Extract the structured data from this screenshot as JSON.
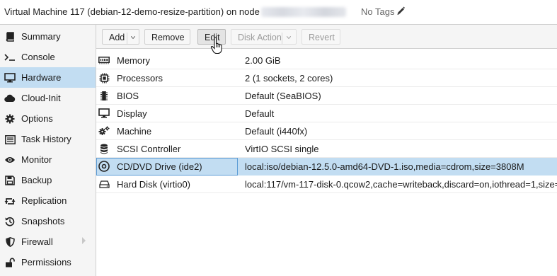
{
  "header": {
    "title": "Virtual Machine 117 (debian-12-demo-resize-partition) on node",
    "tags": "No Tags"
  },
  "sidebar": {
    "items": [
      {
        "label": "Summary",
        "icon": "book-icon"
      },
      {
        "label": "Console",
        "icon": "terminal-icon"
      },
      {
        "label": "Hardware",
        "icon": "monitor-icon",
        "active": true
      },
      {
        "label": "Cloud-Init",
        "icon": "cloud-icon"
      },
      {
        "label": "Options",
        "icon": "gear-icon"
      },
      {
        "label": "Task History",
        "icon": "list-icon"
      },
      {
        "label": "Monitor",
        "icon": "eye-icon"
      },
      {
        "label": "Backup",
        "icon": "floppy-icon"
      },
      {
        "label": "Replication",
        "icon": "retweet-icon"
      },
      {
        "label": "Snapshots",
        "icon": "history-icon"
      },
      {
        "label": "Firewall",
        "icon": "shield-icon"
      },
      {
        "label": "Permissions",
        "icon": "unlock-icon"
      }
    ]
  },
  "toolbar": {
    "add": "Add",
    "remove": "Remove",
    "edit": "Edit",
    "disk_action": "Disk Action",
    "revert": "Revert"
  },
  "hardware": {
    "rows": [
      {
        "name": "Memory",
        "value": "2.00 GiB",
        "icon": "memory-icon"
      },
      {
        "name": "Processors",
        "value": "2 (1 sockets, 2 cores)",
        "icon": "cpu-icon"
      },
      {
        "name": "BIOS",
        "value": "Default (SeaBIOS)",
        "icon": "chip-icon"
      },
      {
        "name": "Display",
        "value": "Default",
        "icon": "desktop-icon"
      },
      {
        "name": "Machine",
        "value": "Default (i440fx)",
        "icon": "cogs-icon"
      },
      {
        "name": "SCSI Controller",
        "value": "VirtIO SCSI single",
        "icon": "database-icon"
      },
      {
        "name": "CD/DVD Drive (ide2)",
        "value": "local:iso/debian-12.5.0-amd64-DVD-1.iso,media=cdrom,size=3808M",
        "icon": "cdrom-icon",
        "selected": true
      },
      {
        "name": "Hard Disk (virtio0)",
        "value": "local:117/vm-117-disk-0.qcow2,cache=writeback,discard=on,iothread=1,size=",
        "icon": "harddisk-icon"
      }
    ]
  },
  "colors": {
    "selection": "#c2ddf2",
    "sidebar_bg": "#f5f5f5",
    "border": "#d0d0d0"
  }
}
